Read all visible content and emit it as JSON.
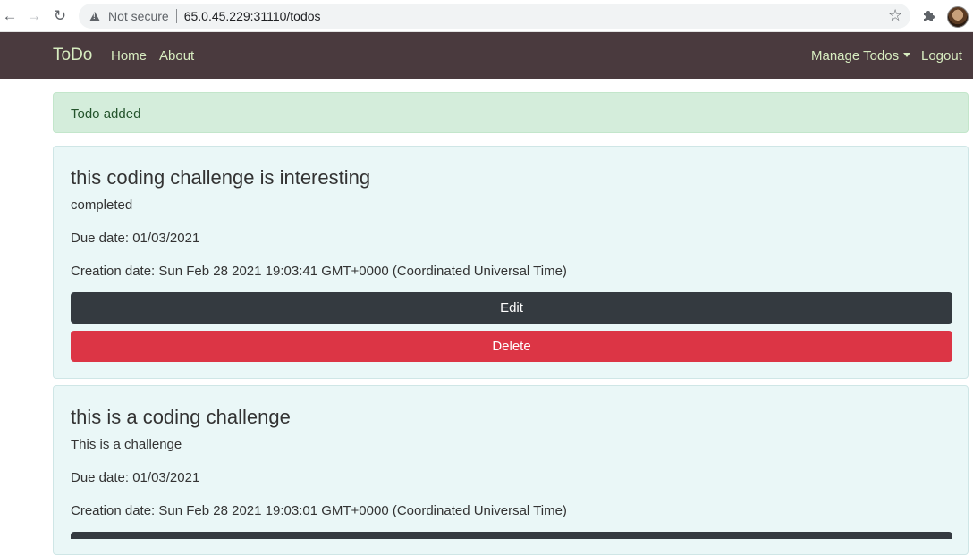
{
  "browser": {
    "security_label": "Not secure",
    "url": "65.0.45.229:31110/todos"
  },
  "navbar": {
    "brand": "ToDo",
    "links": {
      "home": "Home",
      "about": "About"
    },
    "manage": "Manage Todos",
    "logout": "Logout"
  },
  "alert": {
    "message": "Todo added"
  },
  "todos": [
    {
      "title": "this coding challenge is interesting",
      "description": "completed",
      "due": "Due date: 01/03/2021",
      "created": "Creation date: Sun Feb 28 2021 19:03:41 GMT+0000 (Coordinated Universal Time)",
      "edit_label": "Edit",
      "delete_label": "Delete"
    },
    {
      "title": "this is a coding challenge",
      "description": "This is a challenge",
      "due": "Due date: 01/03/2021",
      "created": "Creation date: Sun Feb 28 2021 19:03:01 GMT+0000 (Coordinated Universal Time)"
    }
  ],
  "colors": {
    "navbar_bg": "#4a3a3e",
    "navbar_text": "#d7ecc0",
    "alert_bg": "#d4eddb",
    "card_bg": "#eaf7f7",
    "edit_btn": "#343a40",
    "delete_btn": "#dc3545"
  }
}
